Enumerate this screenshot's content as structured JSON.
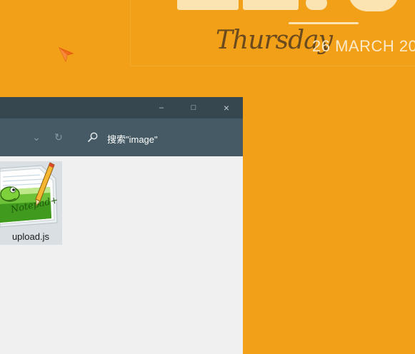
{
  "desktop": {
    "background_color": "#f2a018",
    "clock": {
      "weekday": "Thursday",
      "date": "26 MARCH 20"
    }
  },
  "window": {
    "controls": {
      "minimize": "–",
      "maximize": "□",
      "close": "×"
    },
    "nav": {
      "dropdown": "⌄",
      "refresh": "↻"
    },
    "search": {
      "text": "搜索\"image\""
    },
    "files": [
      {
        "name": "upload.js",
        "icon": "notepad-plus-plus-icon"
      }
    ]
  }
}
